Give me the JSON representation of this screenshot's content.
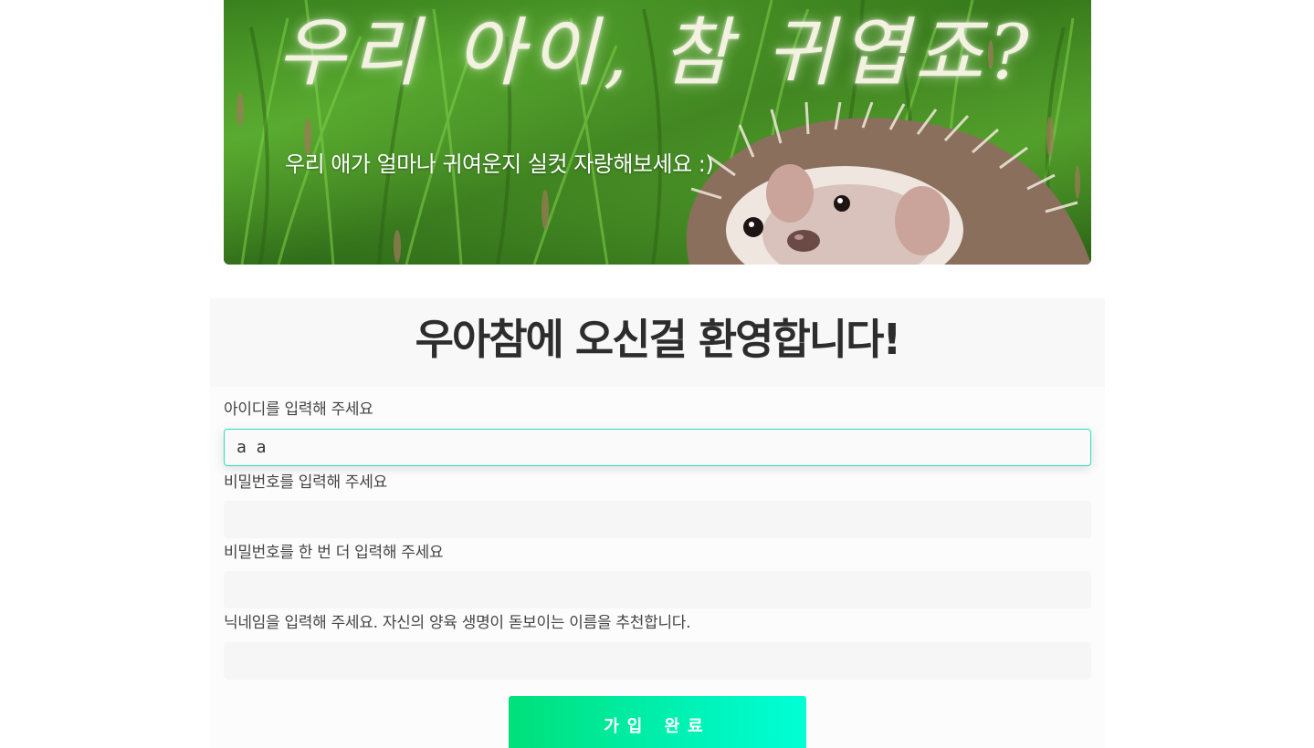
{
  "banner": {
    "title": "우리 아이, 참 귀엽죠?",
    "subtitle": "우리 애가 얼마나 귀여운지 실컷 자랑해보세요 :)"
  },
  "form": {
    "welcome": "우아참에 오신걸 환영합니다!",
    "fields": [
      {
        "label": "아이디를 입력해 주세요",
        "value": "a a",
        "focused": true
      },
      {
        "label": "비밀번호를 입력해 주세요",
        "value": ""
      },
      {
        "label": "비밀번호를 한 번 더 입력해 주세요",
        "value": ""
      },
      {
        "label": "닉네임을 입력해 주세요. 자신의 양육 생명이 돋보이는 이름을 추천합니다.",
        "value": ""
      }
    ],
    "submit_label": "가입 완료"
  },
  "colors": {
    "focus_border": "#29e3b8",
    "button_gradient_start": "#00e07a",
    "button_gradient_end": "#00ffd6"
  }
}
